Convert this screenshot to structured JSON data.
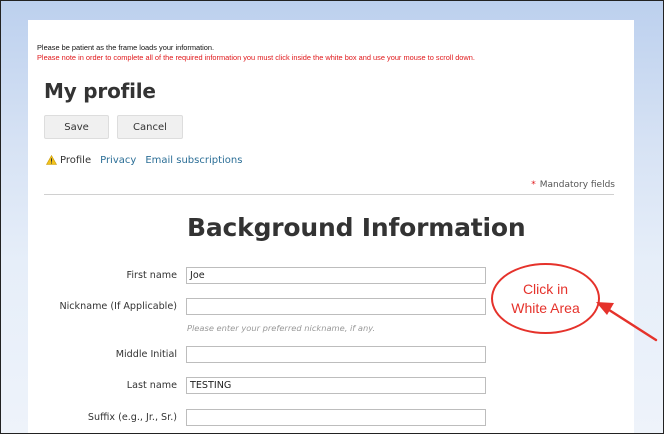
{
  "notices": {
    "line1": "Please be patient as the frame loads your information.",
    "line2": "Please note in order to complete all of the required information you must click inside the white box and use your mouse to scroll down."
  },
  "page": {
    "title": "My profile"
  },
  "actions": {
    "save_label": "Save",
    "cancel_label": "Cancel"
  },
  "tabs": [
    {
      "label": "Profile",
      "icon": "warning-icon",
      "active": true
    },
    {
      "label": "Privacy"
    },
    {
      "label": "Email subscriptions"
    }
  ],
  "mandatory": {
    "star": "*",
    "label": "Mandatory fields"
  },
  "section": {
    "title": "Background Information"
  },
  "fields": [
    {
      "label": "First name",
      "value": "Joe"
    },
    {
      "label": "Nickname (If Applicable)",
      "value": "",
      "hint": "Please enter your preferred nickname, if any."
    },
    {
      "label": "Middle Initial",
      "value": ""
    },
    {
      "label": "Last name",
      "value": "TESTING"
    },
    {
      "label": "Suffix (e.g., Jr., Sr.)",
      "value": ""
    }
  ],
  "callout": {
    "line1": "Click in",
    "line2": "White Area"
  },
  "colors": {
    "notice_red": "#e0181b",
    "link_blue": "#2b6e96",
    "callout_red": "#e5322b",
    "warning_yellow": "#f2c21b"
  }
}
